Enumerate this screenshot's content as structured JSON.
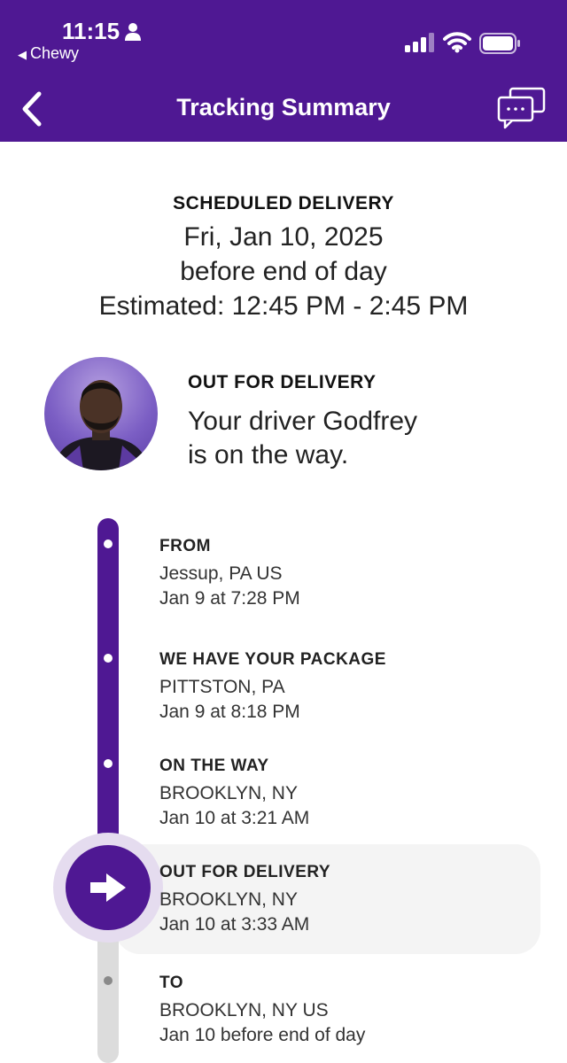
{
  "status": {
    "time": "11:15",
    "back_app": "Chewy"
  },
  "nav": {
    "title": "Tracking Summary"
  },
  "scheduled": {
    "label": "SCHEDULED DELIVERY",
    "date": "Fri, Jan 10, 2025",
    "window": "before end of day",
    "estimate": "Estimated: 12:45 PM - 2:45 PM"
  },
  "driver": {
    "status_label": "OUT FOR DELIVERY",
    "message_line1": "Your driver Godfrey",
    "message_line2": "is on the way."
  },
  "steps": [
    {
      "label": "FROM",
      "location": "Jessup, PA US",
      "time": "Jan 9 at 7:28 PM"
    },
    {
      "label": "WE HAVE YOUR PACKAGE",
      "location": "PITTSTON, PA",
      "time": "Jan 9 at 8:18 PM"
    },
    {
      "label": "ON THE WAY",
      "location": "BROOKLYN, NY",
      "time": "Jan 10 at 3:21 AM"
    },
    {
      "label": "OUT FOR DELIVERY",
      "location": "BROOKLYN, NY",
      "time": "Jan 10 at 3:33 AM"
    },
    {
      "label": "TO",
      "location": "BROOKLYN, NY US",
      "time": "Jan 10 before end of day"
    }
  ],
  "colors": {
    "brand": "#4f1893",
    "track_pending": "#dcdcdc",
    "current_step_bg": "#f4f4f4"
  },
  "icons": {
    "back": "chevron-left-icon",
    "chat": "chat-bubbles-icon",
    "current_step": "arrow-right-icon"
  }
}
